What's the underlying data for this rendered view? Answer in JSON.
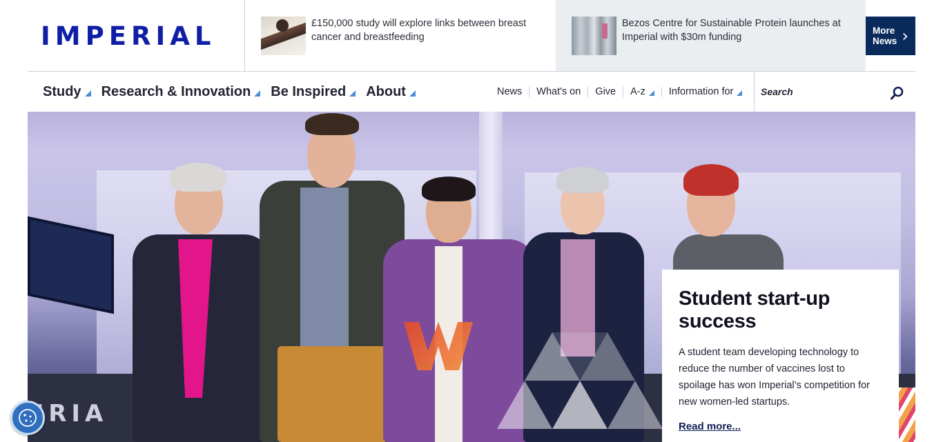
{
  "header": {
    "logo": "IMPERIAL",
    "news": [
      {
        "title": "£150,000 study will explore links between breast cancer and breastfeeding"
      },
      {
        "title": "Bezos Centre for Sustainable Protein launches at Imperial with $30m funding"
      }
    ],
    "more_news": {
      "line1": "More",
      "line2": "News"
    }
  },
  "nav": {
    "primary": [
      "Study",
      "Research & Innovation",
      "Be Inspired",
      "About"
    ],
    "secondary": [
      {
        "label": "News",
        "dropdown": false
      },
      {
        "label": "What's on",
        "dropdown": false
      },
      {
        "label": "Give",
        "dropdown": false
      },
      {
        "label": "A-z",
        "dropdown": true
      },
      {
        "label": "Information for",
        "dropdown": true
      }
    ],
    "search_placeholder": "Search"
  },
  "hero": {
    "banner_text": "ERIA",
    "card": {
      "title": "Student start-up success",
      "body": "A student team developing technology to reduce the number of vaccines lost to spoilage has won Imperial’s competition for new women-led startups.",
      "link": "Read more..."
    }
  },
  "colors": {
    "brand_blue": "#0f1ea6",
    "navy": "#0a2a5c",
    "caret_blue": "#4b8ed6",
    "cookie_blue": "#2f6fbe"
  },
  "icons": {
    "more_news": "chevron-right-icon",
    "search": "search-icon",
    "dropdown": "caret-icon",
    "cookie": "cookie-icon"
  }
}
